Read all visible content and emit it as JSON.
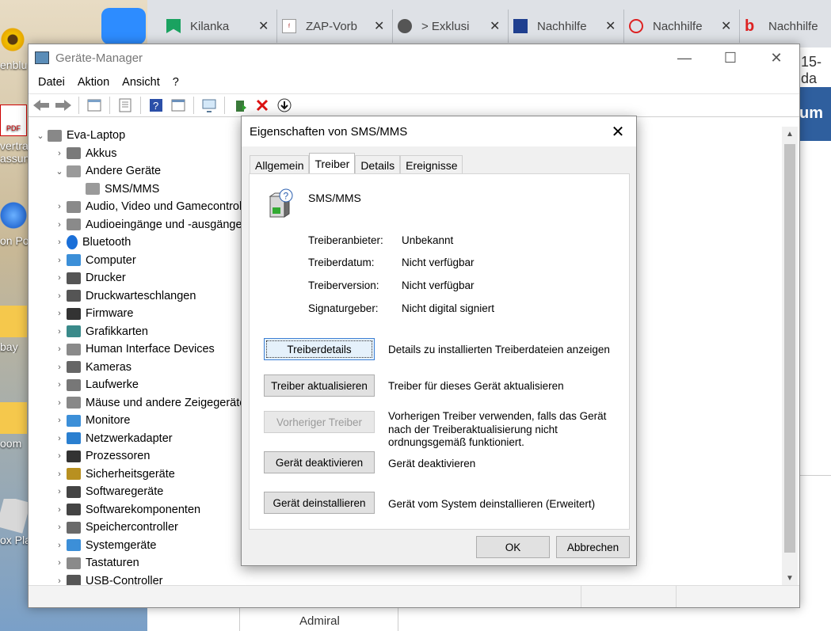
{
  "desktop": {
    "icons": [
      {
        "label": "enblu"
      },
      {
        "label": "vertra"
      },
      {
        "label": "assung"
      },
      {
        "label": "on Po"
      },
      {
        "label": "bay"
      },
      {
        "label": "oom"
      },
      {
        "label": "ox Pla"
      }
    ],
    "pdf_label": "PDF"
  },
  "browser": {
    "tabs": [
      {
        "label": "Kilanka",
        "icon": "bookmark-icon"
      },
      {
        "label": "ZAP-Vorb",
        "icon": "forum-icon"
      },
      {
        "label": "> Exklusi",
        "icon": "globe-icon"
      },
      {
        "label": "Nachhilfe",
        "icon": "pen-icon"
      },
      {
        "label": "Nachhilfe",
        "icon": "sun-icon"
      },
      {
        "label": "Nachhilfe",
        "icon": "b-icon"
      }
    ],
    "side_fragment": "15-da",
    "blue_fragment": "um",
    "footer_text": "Admiral"
  },
  "device_manager": {
    "title": "Geräte-Manager",
    "menu": [
      "Datei",
      "Aktion",
      "Ansicht",
      "?"
    ],
    "tree": {
      "root": "Eva-Laptop",
      "items": [
        {
          "label": "Akkus",
          "icon": "battery-icon",
          "expanded": false
        },
        {
          "label": "Andere Geräte",
          "icon": "unknown-device-icon",
          "expanded": true
        },
        {
          "label": "SMS/MMS",
          "icon": "unknown-device-icon",
          "child": true
        },
        {
          "label": "Audio, Video und Gamecontroller",
          "icon": "speaker-icon"
        },
        {
          "label": "Audioeingänge und -ausgänge",
          "icon": "speaker-icon"
        },
        {
          "label": "Bluetooth",
          "icon": "bluetooth-icon"
        },
        {
          "label": "Computer",
          "icon": "monitor-icon"
        },
        {
          "label": "Drucker",
          "icon": "printer-icon"
        },
        {
          "label": "Druckwarteschlangen",
          "icon": "printer-icon"
        },
        {
          "label": "Firmware",
          "icon": "chip-icon"
        },
        {
          "label": "Grafikkarten",
          "icon": "display-adapter-icon"
        },
        {
          "label": "Human Interface Devices",
          "icon": "keyboard-icon"
        },
        {
          "label": "Kameras",
          "icon": "camera-icon"
        },
        {
          "label": "Laufwerke",
          "icon": "drive-icon"
        },
        {
          "label": "Mäuse und andere Zeigegeräte",
          "icon": "mouse-icon"
        },
        {
          "label": "Monitore",
          "icon": "monitor-icon"
        },
        {
          "label": "Netzwerkadapter",
          "icon": "network-icon"
        },
        {
          "label": "Prozessoren",
          "icon": "chip-icon"
        },
        {
          "label": "Sicherheitsgeräte",
          "icon": "key-icon"
        },
        {
          "label": "Softwaregeräte",
          "icon": "software-icon"
        },
        {
          "label": "Softwarekomponenten",
          "icon": "software-icon"
        },
        {
          "label": "Speichercontroller",
          "icon": "storage-icon"
        },
        {
          "label": "Systemgeräte",
          "icon": "monitor-icon"
        },
        {
          "label": "Tastaturen",
          "icon": "keyboard-icon"
        },
        {
          "label": "USB-Controller",
          "icon": "usb-icon"
        }
      ]
    }
  },
  "dialog": {
    "title": "Eigenschaften von SMS/MMS",
    "tabs": [
      "Allgemein",
      "Treiber",
      "Details",
      "Ereignisse"
    ],
    "active_tab": "Treiber",
    "device_name": "SMS/MMS",
    "fields": [
      {
        "key": "Treiberanbieter:",
        "value": "Unbekannt"
      },
      {
        "key": "Treiberdatum:",
        "value": "Nicht verfügbar"
      },
      {
        "key": "Treiberversion:",
        "value": "Nicht verfügbar"
      },
      {
        "key": "Signaturgeber:",
        "value": "Nicht digital signiert"
      }
    ],
    "actions": [
      {
        "button": "Treiberdetails",
        "desc": "Details zu installierten Treiberdateien anzeigen"
      },
      {
        "button": "Treiber aktualisieren",
        "desc": "Treiber für dieses Gerät aktualisieren"
      },
      {
        "button": "Vorheriger Treiber",
        "desc": "Vorherigen Treiber verwenden, falls das Gerät nach der Treiberaktualisierung nicht ordnungsgemäß funktioniert."
      },
      {
        "button": "Gerät deaktivieren",
        "desc": "Gerät deaktivieren"
      },
      {
        "button": "Gerät deinstallieren",
        "desc": "Gerät vom System deinstallieren (Erweitert)"
      }
    ],
    "ok_label": "OK",
    "cancel_label": "Abbrechen"
  }
}
